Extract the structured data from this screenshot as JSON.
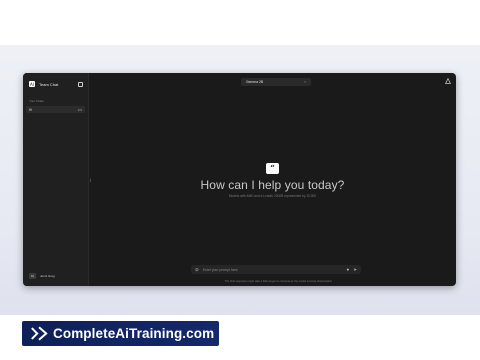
{
  "sidebar": {
    "logo_glyph": "AI",
    "title": "Team Chat",
    "section_label": "Your Chats",
    "chats": [
      {
        "label": "Hi",
        "menu": "•••"
      }
    ],
    "user": {
      "initials": "JG",
      "name": "Jenni Greg"
    }
  },
  "header": {
    "model_name": "Gemma 2B",
    "close_glyph": "×"
  },
  "main": {
    "badge_glyph": "“",
    "title": "How can I help you today?",
    "subtitle": "Models with AMD and a Leader 2000B represented by 10,000"
  },
  "prompt": {
    "placeholder": "Enter your prompt here"
  },
  "disclaimer": "The final response might take a little longer to compute as the model is being downloaded",
  "banner": {
    "text": "CompleteAiTraining.com"
  }
}
